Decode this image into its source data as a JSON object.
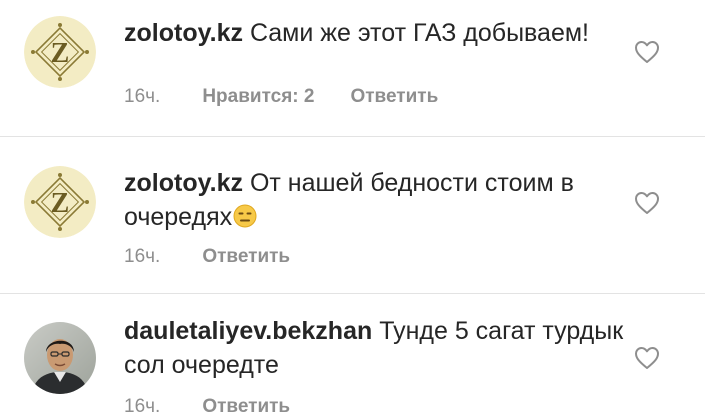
{
  "comments": [
    {
      "username": "zolotoy.kz",
      "text": "Сами же этот ГАЗ добываем!",
      "time": "16ч.",
      "likes": "Нравится: 2",
      "reply": "Ответить",
      "avatar_icon": "zolotoy-logo",
      "like_icon": "heart-outline-icon"
    },
    {
      "username": "zolotoy.kz",
      "text": "От нашей бедности стоим в очередях",
      "emoji": "😑",
      "time": "16ч.",
      "reply": "Ответить",
      "avatar_icon": "zolotoy-logo",
      "like_icon": "heart-outline-icon"
    },
    {
      "username": "dauletaliyev.bekzhan",
      "text": "Тунде 5 сагат турдык сол очередте",
      "time": "16ч.",
      "reply": "Ответить",
      "avatar_icon": "user-photo",
      "like_icon": "heart-outline-icon"
    }
  ],
  "colors": {
    "text": "#262626",
    "meta": "#8e8e8e",
    "logo_bg": "#f3ecc4",
    "logo_gold": "#8a7a35"
  }
}
